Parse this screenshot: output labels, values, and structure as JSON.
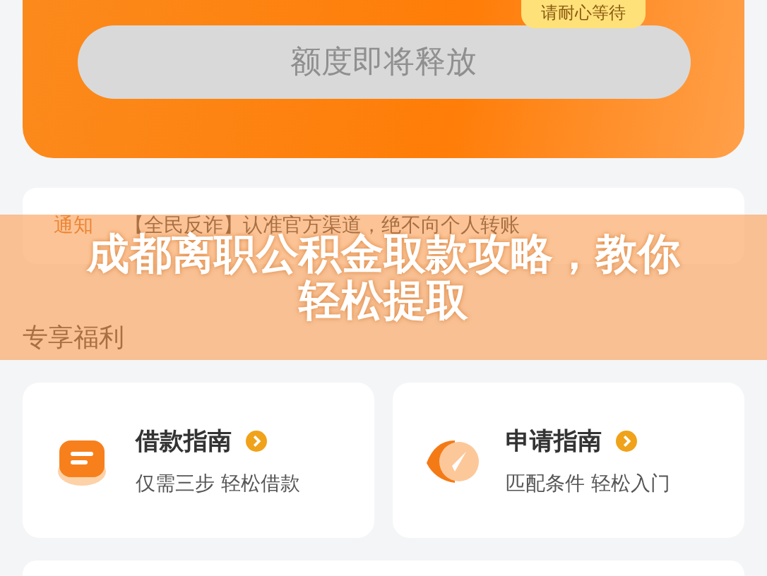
{
  "hero": {
    "badge": "请耐心等待",
    "button": {
      "label": "额度即将释放",
      "disabled": true
    }
  },
  "notice": {
    "tag": "通知",
    "text": "【全民反诈】认准官方渠道，绝不向个人转账"
  },
  "banner": {
    "title": "成都离职公积金取款攻略，教你轻松提取"
  },
  "section_title": "专享福利",
  "cards": [
    {
      "kind": "loan",
      "title": "借款指南",
      "subtitle": "仅需三步 轻松借款"
    },
    {
      "kind": "apply",
      "title": "申请指南",
      "subtitle": "匹配条件 轻松入门"
    }
  ]
}
